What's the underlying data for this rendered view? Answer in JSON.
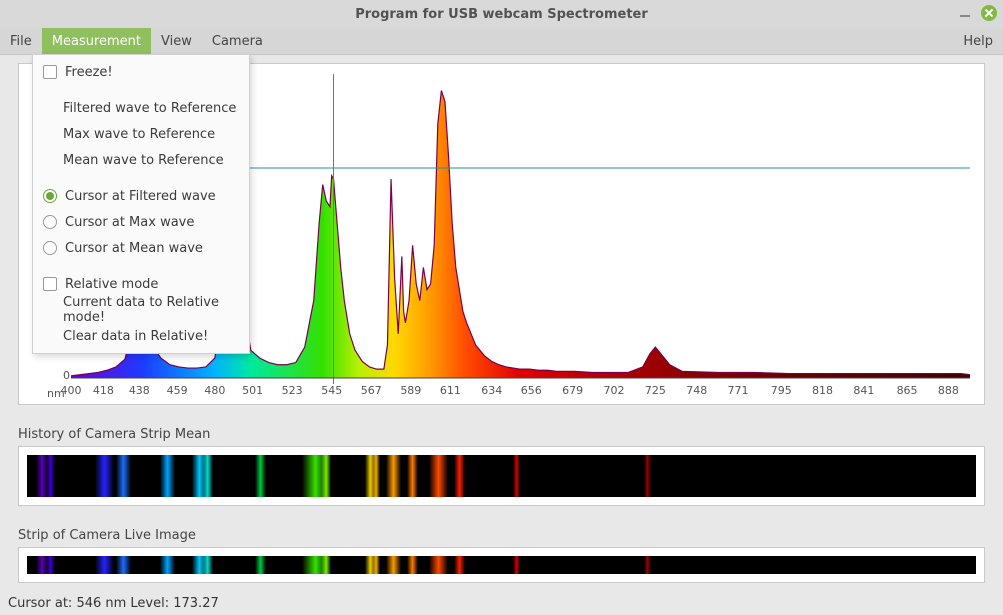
{
  "window": {
    "title": "Program for USB webcam Spectrometer"
  },
  "menu": {
    "file": "File",
    "measurement": "Measurement",
    "view": "View",
    "camera": "Camera",
    "help": "Help"
  },
  "dropdown": {
    "freeze": "Freeze!",
    "filt_ref": "Filtered wave to Reference",
    "max_ref": "Max wave to Reference",
    "mean_ref": "Mean wave to Reference",
    "cur_filt": "Cursor at Filtered wave",
    "cur_max": "Cursor at Max wave",
    "cur_mean": "Cursor at Mean wave",
    "rel_mode": "Relative mode",
    "cur_to_rel": "Current data to Relative mode!",
    "clear_rel": "Clear data in Relative!"
  },
  "plot": {
    "nm_label": "nm",
    "zero_label": "0",
    "xticks": [
      "400",
      "418",
      "438",
      "459",
      "480",
      "501",
      "523",
      "545",
      "567",
      "589",
      "611",
      "634",
      "656",
      "679",
      "702",
      "725",
      "748",
      "771",
      "795",
      "818",
      "841",
      "865",
      "888"
    ],
    "cursor_nm": 546,
    "cursor_level": 173.27,
    "horiz_level": 190
  },
  "panels": {
    "history": "History of Camera Strip Mean",
    "live": "Strip of Camera Live Image"
  },
  "status": {
    "text": "Cursor at: 546 nm  Level: 173.27"
  },
  "chart_data": {
    "type": "area",
    "title": "",
    "xlabel": "nm",
    "ylabel": "",
    "xlim": [
      400,
      900
    ],
    "ylim": [
      0,
      275
    ],
    "cursor_x": 546,
    "horiz_guide_y": 190,
    "x": [
      400,
      405,
      410,
      415,
      420,
      425,
      430,
      432,
      435,
      437,
      440,
      445,
      450,
      455,
      460,
      465,
      470,
      475,
      480,
      483,
      485,
      487,
      490,
      493,
      495,
      498,
      500,
      505,
      510,
      515,
      520,
      525,
      530,
      535,
      538,
      540,
      542,
      544,
      545,
      546,
      548,
      550,
      552,
      555,
      558,
      562,
      566,
      570,
      574,
      576,
      578,
      580,
      582,
      584,
      585,
      586,
      588,
      590,
      592,
      594,
      596,
      598,
      600,
      602,
      604,
      606,
      608,
      610,
      612,
      614,
      616,
      618,
      620,
      625,
      630,
      634,
      638,
      642,
      646,
      650,
      655,
      660,
      665,
      670,
      675,
      680,
      690,
      700,
      710,
      718,
      722,
      725,
      728,
      733,
      740,
      760,
      780,
      800,
      820,
      840,
      860,
      880,
      895,
      900
    ],
    "y": [
      2,
      3,
      4,
      5,
      7,
      10,
      17,
      30,
      75,
      95,
      55,
      30,
      18,
      12,
      10,
      9,
      9,
      10,
      18,
      50,
      120,
      150,
      135,
      105,
      75,
      45,
      25,
      18,
      14,
      12,
      12,
      14,
      28,
      70,
      140,
      175,
      160,
      155,
      183,
      180,
      140,
      100,
      70,
      40,
      25,
      15,
      10,
      8,
      8,
      30,
      180,
      90,
      40,
      110,
      60,
      50,
      70,
      120,
      85,
      70,
      100,
      80,
      85,
      120,
      230,
      260,
      250,
      200,
      140,
      100,
      80,
      60,
      50,
      30,
      20,
      15,
      12,
      10,
      9,
      8,
      8,
      7,
      7,
      6,
      6,
      6,
      5,
      5,
      5,
      10,
      22,
      28,
      22,
      12,
      6,
      5,
      5,
      4,
      4,
      4,
      4,
      4,
      4,
      3
    ],
    "spectral_bands_nm": [
      {
        "nm": 405,
        "color": "#5b00b8",
        "w": 6
      },
      {
        "nm": 410,
        "color": "#3c00d4",
        "w": 5
      },
      {
        "nm": 436,
        "color": "#2323ff",
        "w": 10
      },
      {
        "nm": 447,
        "color": "#1b6cff",
        "w": 8
      },
      {
        "nm": 470,
        "color": "#00a2ff",
        "w": 8
      },
      {
        "nm": 487,
        "color": "#00c8ff",
        "w": 8
      },
      {
        "nm": 492,
        "color": "#00e0d0",
        "w": 6
      },
      {
        "nm": 520,
        "color": "#00c840",
        "w": 6
      },
      {
        "nm": 545,
        "color": "#35e000",
        "w": 14
      },
      {
        "nm": 555,
        "color": "#7af000",
        "w": 5
      },
      {
        "nm": 578,
        "color": "#f0d000",
        "w": 6
      },
      {
        "nm": 582,
        "color": "#f5b000",
        "w": 4
      },
      {
        "nm": 589,
        "color": "#ff9a00",
        "w": 8
      },
      {
        "nm": 600,
        "color": "#ff7a00",
        "w": 6
      },
      {
        "nm": 612,
        "color": "#ff4a00",
        "w": 10
      },
      {
        "nm": 625,
        "color": "#ff2000",
        "w": 6
      },
      {
        "nm": 656,
        "color": "#d40000",
        "w": 4
      },
      {
        "nm": 725,
        "color": "#9b0000",
        "w": 4
      }
    ]
  }
}
